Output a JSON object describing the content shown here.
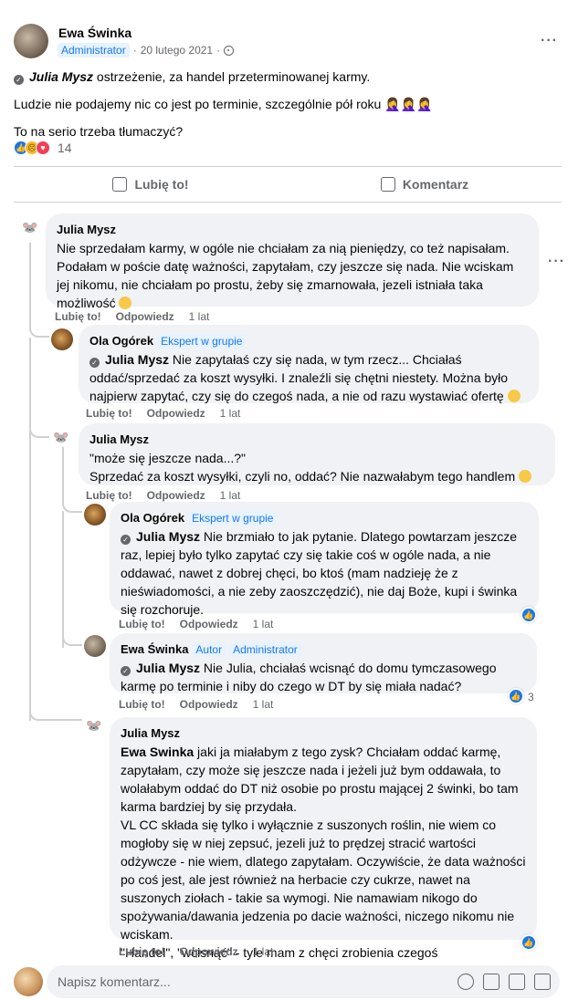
{
  "post": {
    "author": "Ewa Świnka",
    "role_badge": "Administrator",
    "date": "20 lutego 2021",
    "separator": "·",
    "more_icon": "more-horizontal-icon",
    "mention": "Julia Mysz",
    "line1_rest": "ostrzeżenie, za handel przeterminowanej karmy.",
    "line2": "Ludzie nie podajemy nic co jest po terminie, szczególnie pół roku 🤦‍♀️🤦‍♀️🤦‍♀️",
    "line3": "To na serio trzeba tłumaczyć?",
    "reaction_count": "14"
  },
  "actions": {
    "like": "Lubię to!",
    "comment": "Komentarz"
  },
  "comments": [
    {
      "author": "Julia Mysz",
      "text": "Nie sprzedałam karmy, w ogóle nie chciałam za nią pieniędzy, co też napisałam. Podałam w poście datę ważności, zapytałam, czy jeszcze się nada. Nie wciskam jej nikomu, nie chciałam po prostu, żeby się zmarnowała, jezeli istniała taka możliwość",
      "like": "Lubię to!",
      "reply": "Odpowiedz",
      "time": "1 lat"
    },
    {
      "author": "Ola Ogórek",
      "badge": "Ekspert w grupie",
      "mention": "Julia Mysz",
      "text": " Nie zapytałaś czy się nada, w tym rzecz... Chciałaś oddać/sprzedać za koszt wysyłki. I znaleźli się chętni niestety. Można było najpierw zapytać, czy się do czegoś nada, a nie od razu wystawiać ofertę",
      "like": "Lubię to!",
      "reply": "Odpowiedz",
      "time": "1 lat"
    },
    {
      "author": "Julia Mysz",
      "text1": "\"może się jeszcze nada...?\"",
      "text2": "Sprzedać za koszt wysyłki, czyli no, oddać? Nie nazwałabym tego handlem",
      "like": "Lubię to!",
      "reply": "Odpowiedz",
      "time": "1 lat"
    },
    {
      "author": "Ola Ogórek",
      "badge": "Ekspert w grupie",
      "mention": "Julia Mysz",
      "text": " Nie brzmiało to jak pytanie. Dlatego powtarzam jeszcze raz, lepiej było tylko zapytać czy się takie coś w ogóle nada, a nie oddawać, nawet z dobrej chęci, bo ktoś (mam nadzieję że z nieświadomości, a nie zeby zaoszczędzić), nie daj Boże, kupi i świnka się rozchoruje.",
      "like": "Lubię to!",
      "reply": "Odpowiedz",
      "time": "1 lat"
    },
    {
      "author": "Ewa Świnka",
      "badge1": "Autor",
      "badge2": "Administrator",
      "mention": "Julia Mysz",
      "text": " Nie Julia, chciałaś wcisnąć do domu tymczasowego karmę po terminie i niby do czego w DT by się miała nadać?",
      "like": "Lubię to!",
      "reply": "Odpowiedz",
      "time": "1 lat",
      "like_count": "3"
    },
    {
      "author": "Julia Mysz",
      "mention": "Ewa Swinka",
      "text_a": " jaki ja miałabym z tego zysk? Chciałam oddać karmę, zapytałam, czy może się jeszcze nada i jeżeli już bym oddawała, to wolałabym oddać do DT niż osobie po prostu mającej 2 świnki, bo tam karma bardziej by się przydała.",
      "text_b": "VL CC składa się tylko i wyłącznie z suszonych roślin, nie wiem co mogłoby się w niej zepsuć, jezeli już to prędzej stracić wartości odżywcze - nie wiem, dlatego zapytałam. Oczywiście, że data ważności po coś jest, ale jest również na herbacie czy cukrze, nawet na suszonych ziołach - takie sa wymogi. Nie namawiam nikogo do spożywania/dawania jedzenia po dacie ważności, niczego nikomu nie wciskam.",
      "text_c": "\"Handel\", \"wcisnąć\" - tyle mam z chęci zrobienia czegoś bezinteresownie :))",
      "like": "Lubię to!",
      "reply": "Odpowiedz",
      "time": "1 lat"
    }
  ],
  "composer": {
    "placeholder": "Napisz komentarz..."
  }
}
